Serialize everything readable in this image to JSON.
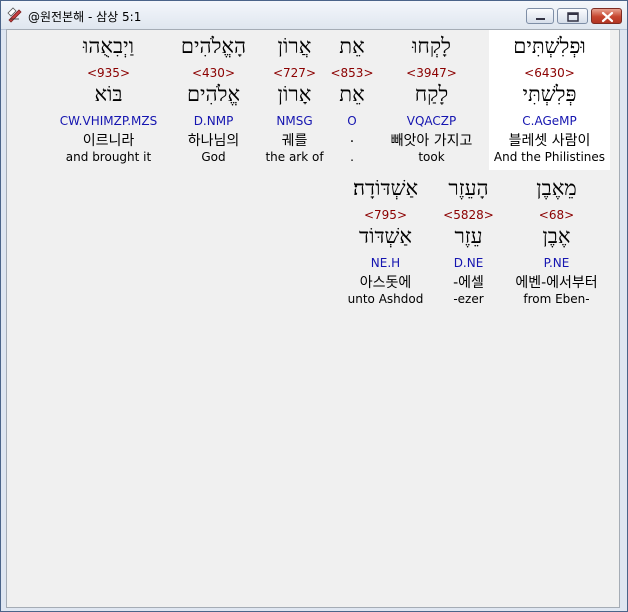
{
  "window": {
    "title": "@원전본해 - 삼상 5:1",
    "colors": {
      "hebrew": "#000000",
      "strong": "#8b0000",
      "morph": "#1515b0",
      "selected_bg": "#ffffff"
    }
  },
  "words": [
    {
      "hebrew": "וּפְלִשְׁתִּים",
      "strong": "<6430>",
      "root": "פְּלִשְׁתִּי",
      "morph": "C.AGeMP",
      "korean": "블레셋 사람이",
      "english": "And the Philistines",
      "selected": true
    },
    {
      "hebrew": "לָקְחוּ",
      "strong": "<3947>",
      "root": "לָקַח",
      "morph": "VQACZP",
      "korean": "빼앗아 가지고",
      "english": "took",
      "selected": false
    },
    {
      "hebrew": "אֵת",
      "strong": "<853>",
      "root": "אֵת",
      "morph": "O",
      "korean": ".",
      "english": ".",
      "selected": false
    },
    {
      "hebrew": "אֲרוֹן",
      "strong": "<727>",
      "root": "אָרוֹן",
      "morph": "NMSG",
      "korean": "궤를",
      "english": "the ark of",
      "selected": false
    },
    {
      "hebrew": "הָאֱלֹהִים",
      "strong": "<430>",
      "root": "אֱלֹהִים",
      "morph": "D.NMP",
      "korean": "하나님의",
      "english": "God",
      "selected": false
    },
    {
      "hebrew": "וַיְבִאֻהוּ",
      "strong": "<935>",
      "root": "בּוֹא",
      "morph": "CW.VHIMZP.MZS",
      "korean": "이르니라",
      "english": "and brought it",
      "selected": false
    },
    {
      "hebrew": "מֵאֶבֶן",
      "strong": "<68>",
      "root": "אֶבֶן",
      "morph": "P.NE",
      "korean": "에벤-에서부터",
      "english": "from Eben-",
      "selected": false
    },
    {
      "hebrew": "הָעֵזֶר",
      "strong": "<5828>",
      "root": "עֵזֶר",
      "morph": "D.NE",
      "korean": "-에셀",
      "english": "-ezer",
      "selected": false
    },
    {
      "hebrew": "אַשְׁדּוֹדָה׃",
      "strong": "<795>",
      "root": "אַשְׁדּוֹד",
      "morph": "NE.H",
      "korean": "아스돗에",
      "english": "unto Ashdod",
      "selected": false
    }
  ]
}
